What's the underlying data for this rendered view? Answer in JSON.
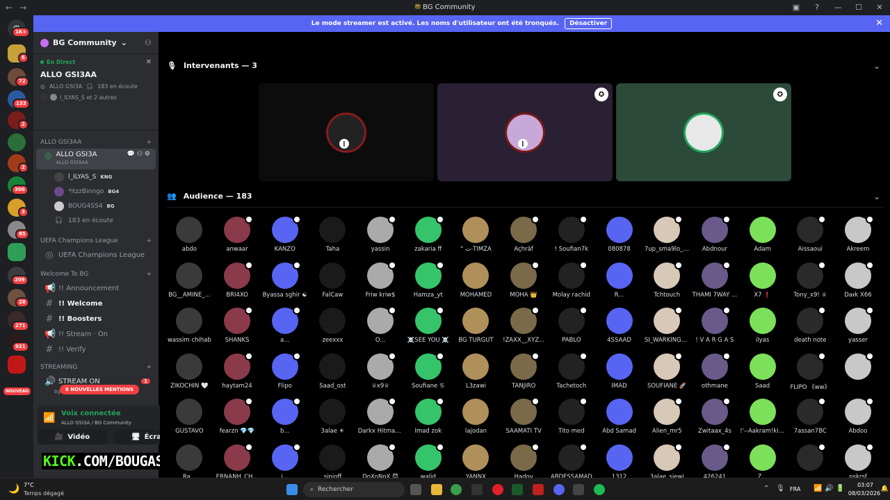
{
  "window": {
    "title": "BG Community",
    "back": "←",
    "forward": "→"
  },
  "banner": {
    "text": "Le mode streamer est activé. Les noms d'utilisateur ont été tronqués.",
    "button": "Désactiver"
  },
  "guilds": {
    "top_badge": "1K+",
    "badges": [
      "6",
      "72",
      "133",
      "2",
      "2",
      "300",
      "3",
      "85",
      "209",
      "28",
      "271",
      "921"
    ],
    "nouveau": "NOUVEAU"
  },
  "server": {
    "name": "BG Community"
  },
  "live": {
    "tag": "En Direct",
    "channel": "ALLO GSI3AA",
    "host": "ALLO GSI3A",
    "listeners": "183 en écoute",
    "speakers": "l_ILYAS_S et 2 autres"
  },
  "categories": {
    "allo": "ALLO GSI3AA",
    "ucl": "UEFA Champions League",
    "welcome": "Welcome To BG",
    "streaming": "STREAMING"
  },
  "stage_channel": {
    "name": "ALLO GSI3A",
    "sub": "ALLO GSI3AA"
  },
  "voice_users": [
    {
      "name": "l_ILYAS_S",
      "tag": "KNG"
    },
    {
      "name": "*itzzBinngo",
      "tag": "BG4"
    },
    {
      "name": "BOUG4SS4",
      "tag": "BG"
    },
    {
      "name": "183 en écoute",
      "tag": ""
    }
  ],
  "ucl_channel": "UEFA Champions League",
  "text_channels": [
    {
      "name": "!! Announcement",
      "bold": false
    },
    {
      "name": "!! Welcome",
      "bold": true
    },
    {
      "name": "!! Boosters",
      "bold": true
    },
    {
      "name": "!! Stream · On",
      "bold": false
    },
    {
      "name": "!! Verify",
      "bold": false
    }
  ],
  "stream_channel": {
    "name": "STREAM ON",
    "badge": "1",
    "sub": "bg on"
  },
  "mentions": "6 NOUVELLES MENTIONS",
  "voice_panel": {
    "status": "Voix connectée",
    "sub": "ALLO GSI3A / BG Community",
    "video": "Vidéo",
    "screen": "Écran"
  },
  "kick": {
    "prefix": "KICK",
    "rest": ".COM/BOUGASSAA"
  },
  "speakers_header": "Intervenants — 3",
  "audience_header": "Audience — 183",
  "audience": [
    "abdo",
    "anwaar",
    "KANZO",
    "Taha",
    "yassin",
    "zakaria ff",
    "° ت-TIMZA",
    "Açhrâf",
    "! Soufian7k",
    "080878",
    "7up_sma9lo_l...",
    "Abdnour",
    "Adam",
    "Aissaoui",
    "Akreem",
    "BG__AMINE_...",
    "BRI4XO",
    "Byassa sghir ☯",
    "FalCaw",
    "Friw kriw$",
    "Hamza_yt",
    "MOHAMED",
    "MOHA 👑",
    "Molay rachid",
    "R...",
    "Tchtouch",
    "THAMI 7WAY ...",
    "X7 ❗",
    "Tony_x9! ♕",
    "Da𝖗k X66",
    "wassim chihab",
    "SHANKS",
    "a...",
    "zeexxx",
    "O...",
    "☠️SEE YOU ☠️",
    "BG TURGUT",
    "!ZAXX__XYZ...",
    "PABLO",
    "4SSAAD",
    "SI_WARKINGv™",
    "! V A R G A S",
    "ilyas",
    "death note",
    "yasser",
    "ZIKOCHIN 🤍",
    "haytam24",
    "Flipo",
    "Saad_ost",
    "♕x9♕",
    "Soufiane ♋",
    "L3zawi",
    "TANJIRO",
    "Tachetoch",
    "IMAD",
    "SOUFIANE 🚀",
    "othmane",
    "Saad",
    "FLIPO 《ᴡᴡ》",
    "",
    "GUSTAVO",
    "fearzn 💎💎",
    "b...",
    "3alae ☀",
    "Darkx Hitman 4",
    "Imad zok",
    "lajodan",
    "SAAMATI TV",
    "Tito med",
    "Abd Samad",
    "Alien_mr5",
    "Zwitaax_4s",
    "!'--Aakram!king",
    "7assan7BC",
    "Abdoo",
    "Ra...",
    "ERNANH_CH...",
    "i...",
    "sinioff",
    "DoXoNoX 😈",
    "walid",
    "YANNX",
    "Hadoy",
    "ABDESSAMAD",
    "1312",
    "3alae_siewi",
    "426241",
    "Z...",
    "",
    "pskrsf"
  ],
  "taskbar": {
    "weather_temp": "7°C",
    "weather_text": "Temps dégagé",
    "search": "Rechercher",
    "lang": "FRA",
    "time": "03:07",
    "date": "08/03/2026"
  },
  "colors": {
    "accent": "#5865f2",
    "red": "#f23f42",
    "green": "#23a55a",
    "kick": "#53fc18"
  }
}
